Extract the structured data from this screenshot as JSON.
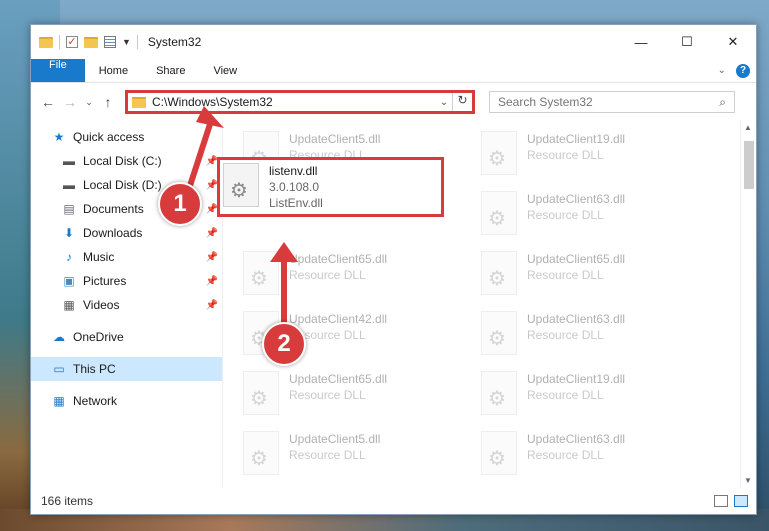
{
  "window": {
    "title": "System32",
    "minimize": "—",
    "maximize": "☐",
    "close": "✕"
  },
  "ribbon": {
    "tabs": [
      "File",
      "Home",
      "Share",
      "View"
    ]
  },
  "nav_bar": {
    "address": "C:\\Windows\\System32",
    "search_placeholder": "Search System32"
  },
  "sidebar": {
    "quick_access": "Quick access",
    "items": [
      {
        "label": "Local Disk (C:)",
        "icon": "drive-icon"
      },
      {
        "label": "Local Disk (D:)",
        "icon": "drive-icon"
      },
      {
        "label": "Documents",
        "icon": "documents-icon"
      },
      {
        "label": "Downloads",
        "icon": "downloads-icon"
      },
      {
        "label": "Music",
        "icon": "music-icon"
      },
      {
        "label": "Pictures",
        "icon": "pictures-icon"
      },
      {
        "label": "Videos",
        "icon": "videos-icon"
      }
    ],
    "onedrive": "OneDrive",
    "this_pc": "This PC",
    "network": "Network"
  },
  "files": [
    {
      "name": "UpdateClient5.dll",
      "type": "Resource DLL"
    },
    {
      "name": "UpdateClient19.dll",
      "type": "Resource DLL"
    },
    {
      "name": "",
      "type": ""
    },
    {
      "name": "UpdateClient63.dll",
      "type": "Resource DLL"
    },
    {
      "name": "UpdateClient65.dll",
      "type": "Resource DLL"
    },
    {
      "name": "UpdateClient65.dll",
      "type": "Resource DLL"
    },
    {
      "name": "UpdateClient42.dll",
      "type": "Resource DLL"
    },
    {
      "name": "UpdateClient63.dll",
      "type": "Resource DLL"
    },
    {
      "name": "UpdateClient65.dll",
      "type": "Resource DLL"
    },
    {
      "name": "UpdateClient19.dll",
      "type": "Resource DLL"
    },
    {
      "name": "UpdateClient5.dll",
      "type": "Resource DLL"
    },
    {
      "name": "UpdateClient63.dll",
      "type": "Resource DLL"
    }
  ],
  "highlighted_file": {
    "name": "listenv.dll",
    "version": "3.0.108.0",
    "description": "ListEnv.dll"
  },
  "status": {
    "count": "166 items"
  },
  "callouts": [
    "1",
    "2"
  ],
  "colors": {
    "accent": "#1979ca",
    "highlight_border": "#d83b3b"
  }
}
